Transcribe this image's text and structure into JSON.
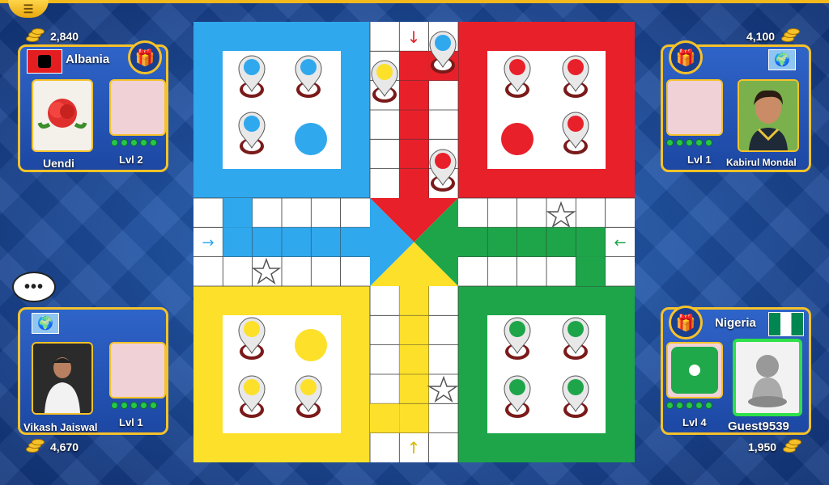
{
  "top_left": {
    "coins": "2,840",
    "country": "Albania",
    "player_name": "Uendi",
    "level": "Lvl 2"
  },
  "top_right": {
    "coins": "4,100",
    "player_name": "Kabirul Mondal",
    "level": "Lvl 1"
  },
  "bottom_left": {
    "coins": "4,670",
    "player_name": "Vikash Jaiswal",
    "level": "Lvl 1",
    "chat_bubble": "•••"
  },
  "bottom_right": {
    "coins": "1,950",
    "country": "Nigeria",
    "player_name": "Guest9539",
    "level": "Lvl 4"
  },
  "colors": {
    "blue": "#2fa8ee",
    "red": "#e8202a",
    "green": "#1ea54a",
    "yellow": "#fde02a"
  },
  "board": {
    "pieces": {
      "blue_home": 3,
      "red_home": 3,
      "green_home": 4,
      "yellow_home": 3,
      "blue_on_track": 1,
      "red_on_track": 1,
      "yellow_on_track": 1
    }
  }
}
